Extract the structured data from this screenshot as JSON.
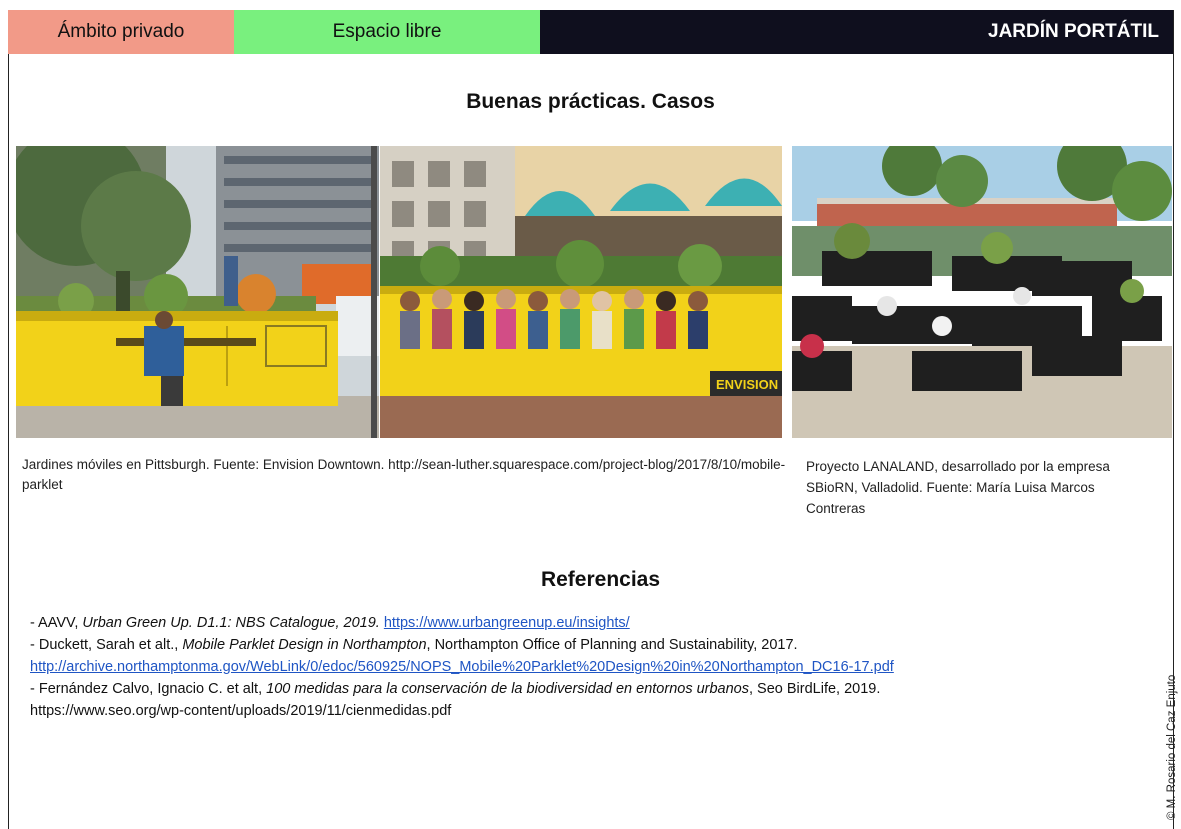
{
  "header": {
    "tab_private": "Ámbito privado",
    "tab_free": "Espacio libre",
    "title": "JARDÍN PORTÁTIL"
  },
  "cases": {
    "heading": "Buenas prácticas. Casos",
    "caption_pittsburgh": "Jardines móviles en Pittsburgh. Fuente: Envision Downtown. http://sean-luther.squarespace.com/project-blog/2017/8/10/mobile-parklet",
    "caption_lanaland": "Proyecto LANALAND, desarrollado por la empresa SBioRN, Valladolid. Fuente: María Luisa Marcos Contreras",
    "dumpster_label": "ENVISION"
  },
  "references": {
    "heading": "Referencias",
    "r1_prefix": "- AAVV, ",
    "r1_title": "Urban Green Up.  D1.1: NBS Catalogue, 2019.",
    "r1_link": "https://www.urbangreenup.eu/insights/",
    "r2_prefix": "- Duckett, Sarah et alt., ",
    "r2_title": "Mobile Parklet Design in Northampton",
    "r2_suffix": ", Northampton Office of Planning and Sustainability, 2017.",
    "r2_link": "http://archive.northamptonma.gov/WebLink/0/edoc/560925/NOPS_Mobile%20Parklet%20Design%20in%20Northampton_DC16-17.pdf",
    "r3_prefix": "- Fernández Calvo, Ignacio C. et alt, ",
    "r3_title": "100 medidas para la conservación de la biodiversidad en entornos urbanos",
    "r3_suffix": ", Seo BirdLife, 2019.",
    "r3_url": "https://www.seo.org/wp-content/uploads/2019/11/cienmedidas.pdf"
  },
  "credit": "© M. Rosario del Caz Enjuto",
  "colors": {
    "tab_private_bg": "#f29a88",
    "tab_free_bg": "#79f07e",
    "title_bar_bg": "#0f0f1e",
    "link": "#1f55c4",
    "dumpster_yellow": "#f2d219"
  }
}
